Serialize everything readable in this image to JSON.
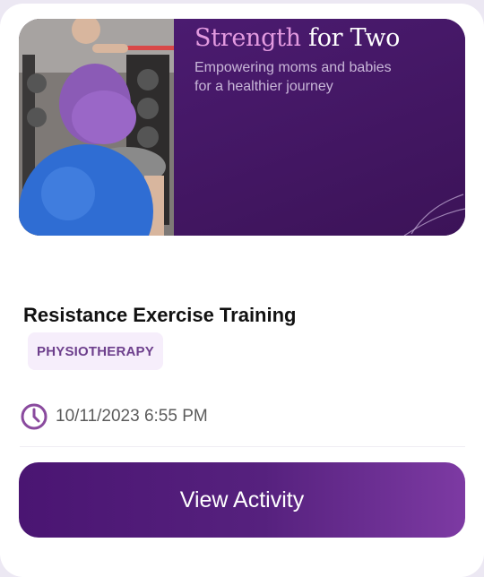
{
  "banner": {
    "headline_accent": "Strength",
    "headline_rest": " for Two",
    "subtitle": "Empowering moms and babies for a healthier journey"
  },
  "activity": {
    "title": "Resistance Exercise Training",
    "category": "PHYSIOTHERAPY",
    "datetime": "10/11/2023 6:55 PM"
  },
  "actions": {
    "view_label": "View Activity"
  },
  "colors": {
    "brand": "#4a1572",
    "accent_pink": "#e39ae0",
    "tag_bg": "#f6eefb",
    "tag_text": "#6d3f8c",
    "clock": "#8a4a9e"
  },
  "icons": {
    "clock": "clock-icon",
    "leaf": "leaf-icon"
  }
}
